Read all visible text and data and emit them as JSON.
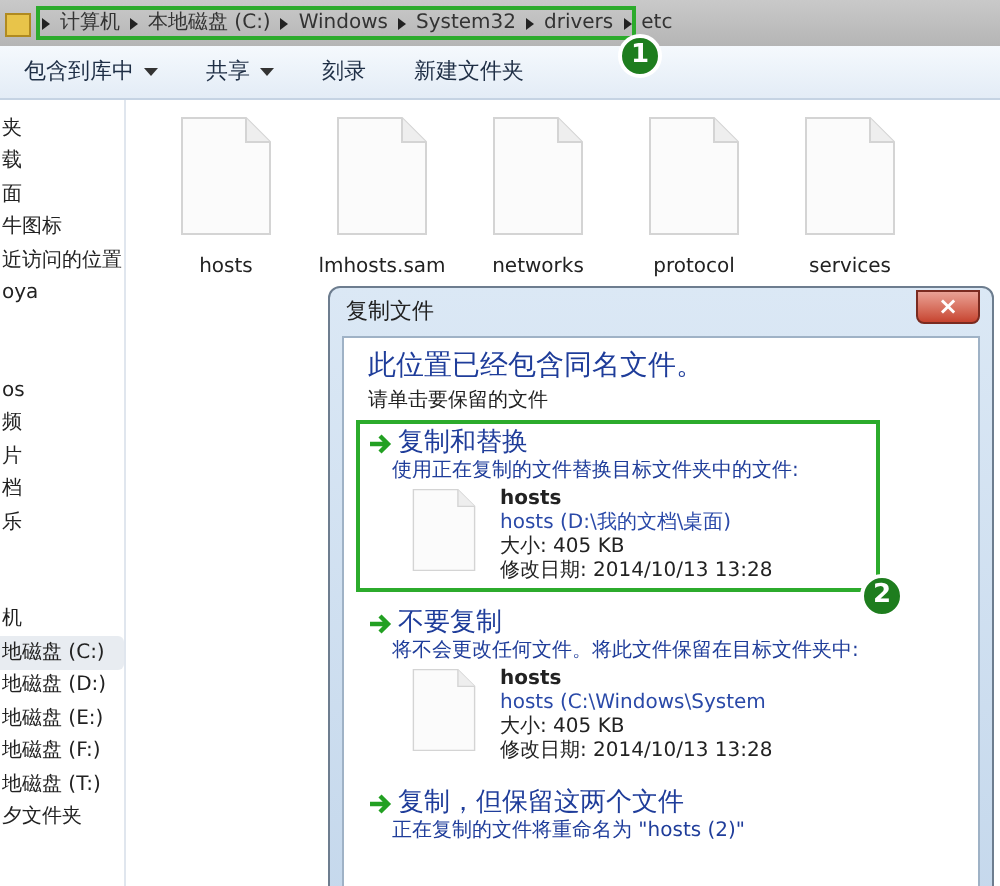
{
  "address_bar": {
    "segments": [
      "计算机",
      "本地磁盘 (C:)",
      "Windows",
      "System32",
      "drivers",
      "etc"
    ]
  },
  "toolbar": {
    "items": [
      {
        "label": "包含到库中",
        "dropdown": true
      },
      {
        "label": "共享",
        "dropdown": true
      },
      {
        "label": "刻录",
        "dropdown": false
      },
      {
        "label": "新建文件夹",
        "dropdown": false
      }
    ]
  },
  "sidebar": {
    "groups": [
      {
        "items": [
          {
            "label": "夹",
            "selected": false
          },
          {
            "label": "载",
            "selected": false
          },
          {
            "label": "面",
            "selected": false
          },
          {
            "label": "牛图标",
            "selected": false
          },
          {
            "label": "近访问的位置",
            "selected": false
          },
          {
            "label": "oya",
            "selected": false
          }
        ]
      },
      {
        "items": [
          {
            "label": "os",
            "selected": false
          },
          {
            "label": "频",
            "selected": false
          },
          {
            "label": "片",
            "selected": false
          },
          {
            "label": "档",
            "selected": false
          },
          {
            "label": "乐",
            "selected": false
          }
        ]
      },
      {
        "items": [
          {
            "label": "机",
            "selected": false
          },
          {
            "label": "地磁盘 (C:)",
            "selected": true
          },
          {
            "label": "地磁盘 (D:)",
            "selected": false
          },
          {
            "label": "地磁盘 (E:)",
            "selected": false
          },
          {
            "label": "地磁盘 (F:)",
            "selected": false
          },
          {
            "label": "地磁盘 (T:)",
            "selected": false
          },
          {
            "label": "夕文件夹",
            "selected": false
          }
        ]
      }
    ]
  },
  "files": [
    "hosts",
    "lmhosts.sam",
    "networks",
    "protocol",
    "services"
  ],
  "dialog": {
    "title": "复制文件",
    "close": "×",
    "heading": "此位置已经包含同名文件。",
    "instruction": "请单击要保留的文件",
    "options": [
      {
        "title": "复制和替换",
        "description": "使用正在复制的文件替换目标文件夹中的文件:",
        "file": {
          "name": "hosts",
          "path": "hosts (D:\\我的文档\\桌面)",
          "size": "大小: 405 KB",
          "modified": "修改日期: 2014/10/13 13:28"
        },
        "highlighted": true
      },
      {
        "title": "不要复制",
        "description": "将不会更改任何文件。将此文件保留在目标文件夹中:",
        "file": {
          "name": "hosts",
          "path": "hosts (C:\\Windows\\System",
          "size": "大小: 405 KB",
          "modified": "修改日期: 2014/10/13 13:28"
        },
        "highlighted": false
      },
      {
        "title": "复制，但保留这两个文件",
        "description": "正在复制的文件将重命名为 \"hosts (2)\"",
        "highlighted": false
      }
    ]
  },
  "annotations": [
    "1",
    "2"
  ]
}
